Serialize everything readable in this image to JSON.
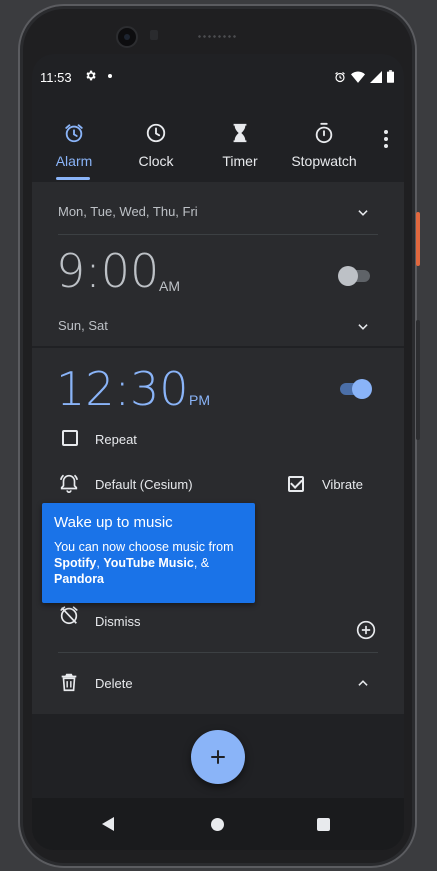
{
  "status_bar": {
    "time": "11:53"
  },
  "tabs": [
    {
      "label": "Alarm",
      "icon": "alarm-icon",
      "active": true
    },
    {
      "label": "Clock",
      "icon": "clock-icon",
      "active": false
    },
    {
      "label": "Timer",
      "icon": "hourglass-icon",
      "active": false
    },
    {
      "label": "Stopwatch",
      "icon": "stopwatch-icon",
      "active": false
    }
  ],
  "alarm_1": {
    "days": "Mon, Tue, Wed, Thu, Fri",
    "time": "9:00",
    "ampm": "AM",
    "enabled": false
  },
  "alarm_2": {
    "days": "Sun, Sat",
    "time": "12:30",
    "ampm": "PM",
    "enabled": true,
    "repeat_label": "Repeat",
    "ringtone_label": "Default (Cesium)",
    "vibrate_label": "Vibrate",
    "dismiss_label": "Dismiss",
    "delete_label": "Delete"
  },
  "tooltip": {
    "title": "Wake up to music",
    "body_prefix": "You can now choose music from ",
    "spotify": "Spotify",
    "separator_1": ", ",
    "youtube_music": "YouTube Music",
    "separator_2": ", & ",
    "pandora": "Pandora"
  },
  "colors": {
    "accent": "#8ab4f8",
    "tooltip_bg": "#1a73e8",
    "background": "#202124",
    "card": "#2a2b2e"
  }
}
